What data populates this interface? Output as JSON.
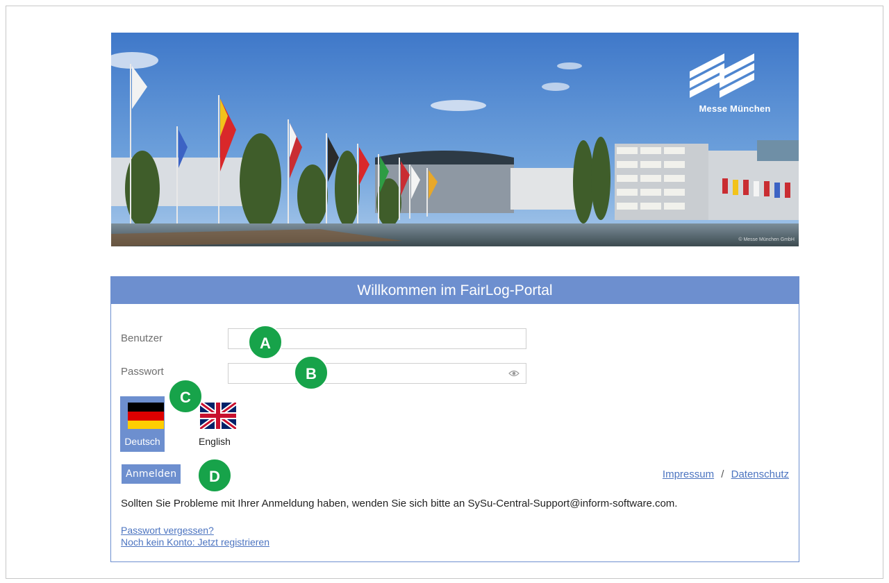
{
  "banner": {
    "logo_text": "Messe München",
    "copyright": "© Messe München GmbH"
  },
  "panel": {
    "title": "Willkommen im FairLog-Portal",
    "user_label": "Benutzer",
    "user_value": "",
    "password_label": "Passwort",
    "password_value": ""
  },
  "languages": [
    {
      "label": "Deutsch",
      "selected": true
    },
    {
      "label": "English",
      "selected": false
    }
  ],
  "login_label": "Anmelden",
  "footer_links": {
    "impressum": "Impressum",
    "separator": "/",
    "datenschutz": "Datenschutz"
  },
  "help_text": "Sollten Sie Probleme mit Ihrer Anmeldung haben, wenden Sie sich bitte an SySu-Central-Support@inform-software.com.",
  "forgot_password": "Passwort vergessen?",
  "register": "Noch kein Konto: Jetzt registrieren",
  "markers": {
    "a": "A",
    "b": "B",
    "c": "C",
    "d": "D"
  },
  "colors": {
    "accent": "#6d8fcf",
    "link": "#4c74c0",
    "marker": "#17a34a"
  }
}
